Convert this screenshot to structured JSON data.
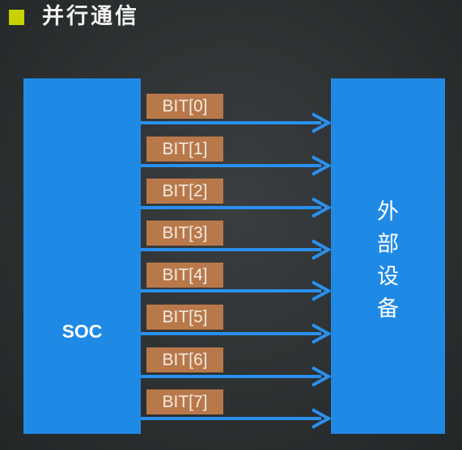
{
  "title": "并行通信",
  "soc_label": "SOC",
  "device_label_chars": [
    "外",
    "部",
    "设",
    "备"
  ],
  "bits": [
    "BIT[0]",
    "BIT[1]",
    "BIT[2]",
    "BIT[3]",
    "BIT[4]",
    "BIT[5]",
    "BIT[6]",
    "BIT[7]"
  ],
  "colors": {
    "bullet": "#c8d200",
    "box": "#1f8ae6",
    "bit_label": "#b8784a",
    "wire": "#2a90ee"
  }
}
